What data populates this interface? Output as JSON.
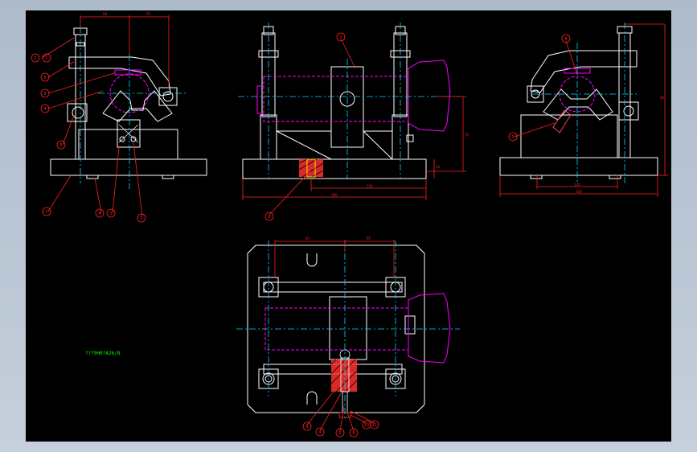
{
  "colors": {
    "background": "#000000",
    "outline": "#ffffff",
    "dimension": "#ff2020",
    "centerline": "#00d8ff",
    "workpiece": "#ff00ff",
    "section": "#ff3030",
    "note": "#00ff00"
  },
  "drawing": {
    "note_text": "???9H0?A26/8",
    "front_view": {
      "dims": {
        "top_left": "60",
        "top_right": "75"
      },
      "balloons": [
        "2",
        "1",
        "5",
        "3",
        "4",
        "6",
        "7",
        "4",
        "3",
        "1"
      ]
    },
    "side_view": {
      "dims": {
        "width_inner": "150",
        "width_outer": "180",
        "height": "70",
        "base_height": "20"
      },
      "balloons": [
        "7",
        "8"
      ]
    },
    "right_view": {
      "dims": {
        "top_left": "40",
        "width_inner": "120",
        "width_outer": "190",
        "height": "60"
      },
      "balloons": [
        "8",
        "3"
      ]
    },
    "top_view": {
      "dims": {
        "top_left": "85",
        "top_right": "95"
      },
      "balloons": [
        "9",
        "4",
        "5",
        "6",
        "10",
        "11"
      ]
    }
  }
}
